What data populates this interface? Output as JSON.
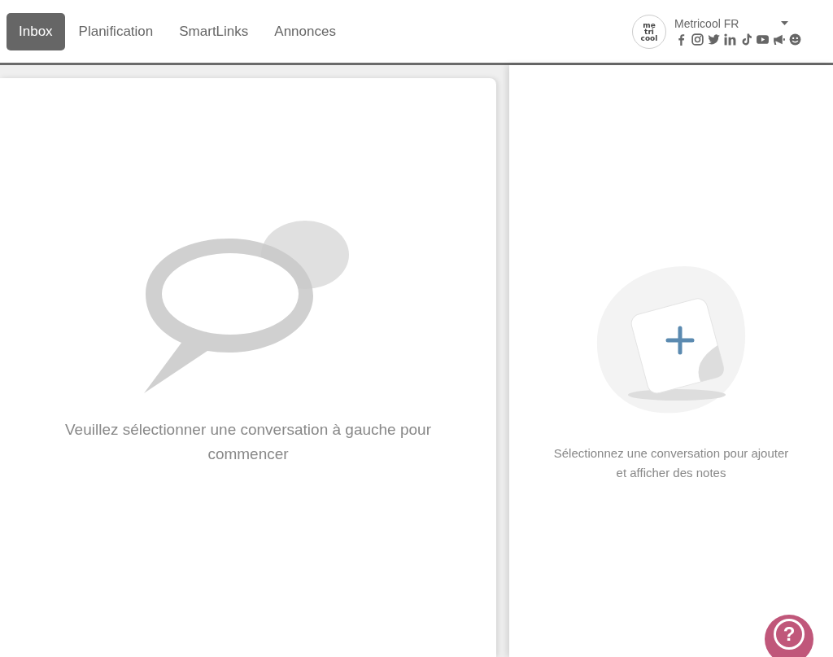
{
  "nav_tabs": [
    {
      "label": "Inbox",
      "selected": true
    },
    {
      "label": "Planification",
      "selected": false
    },
    {
      "label": "SmartLinks",
      "selected": false
    },
    {
      "label": "Annonces",
      "selected": false
    }
  ],
  "account": {
    "logo_lines": [
      "me",
      "tri",
      "cool"
    ],
    "name": "Metricool FR"
  },
  "conversation_panel": {
    "message": "Veuillez sélectionner une conversation à gauche pour commencer"
  },
  "notes_panel": {
    "message": "Sélectionnez une conversation pour ajouter et afficher des notes"
  },
  "help_button": {
    "label": "?"
  }
}
